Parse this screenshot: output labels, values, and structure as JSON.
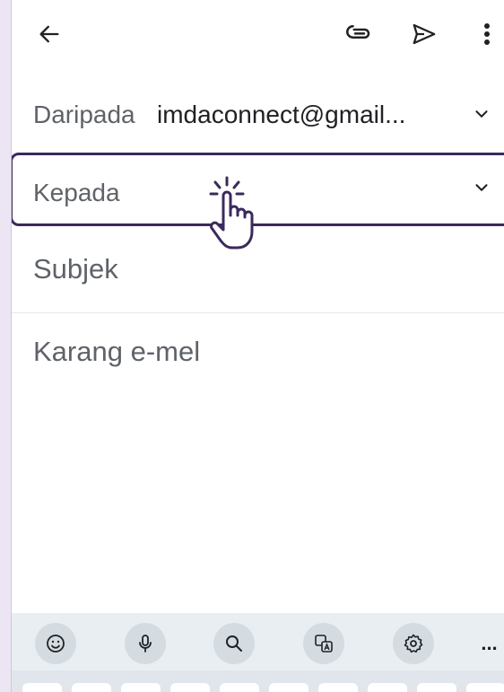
{
  "compose": {
    "from_label": "Daripada",
    "from_value": "imdaconnect@gmail...",
    "to_label": "Kepada",
    "subject_placeholder": "Subjek",
    "body_placeholder": "Karang e-mel"
  },
  "toolbar": {
    "icons": [
      "arrow-back-icon",
      "attach-icon",
      "send-icon",
      "more-vert-icon"
    ]
  },
  "keyboard": {
    "toolbar_icons": [
      "emoji-icon",
      "mic-icon",
      "search-icon",
      "translate-icon",
      "settings-icon",
      "more-horiz-icon"
    ],
    "more_label": "..."
  },
  "colors": {
    "highlight_border": "#3b2a5c",
    "page_background": "#ece6f4"
  }
}
